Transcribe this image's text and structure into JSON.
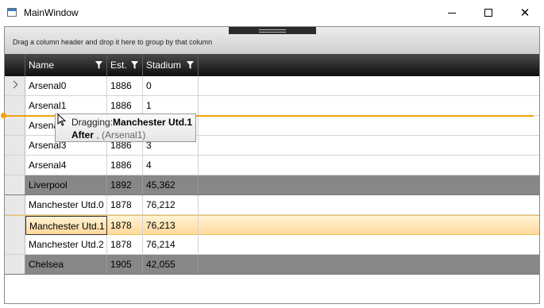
{
  "window": {
    "title": "MainWindow"
  },
  "grid": {
    "group_panel_text": "Drag a column header and drop it here to group by that column",
    "columns": [
      "Name",
      "Est.",
      "Stadium"
    ],
    "rows": [
      {
        "name": "Arsenal0",
        "est": "1886",
        "stadium": "0",
        "style": "normal",
        "current": true
      },
      {
        "name": "Arsenal1",
        "est": "1886",
        "stadium": "1",
        "style": "normal"
      },
      {
        "name": "Arsenal2",
        "est": "1886",
        "stadium": "2",
        "style": "normal"
      },
      {
        "name": "Arsenal3",
        "est": "1886",
        "stadium": "3",
        "style": "normal"
      },
      {
        "name": "Arsenal4",
        "est": "1886",
        "stadium": "4",
        "style": "normal"
      },
      {
        "name": "Liverpool",
        "est": "1892",
        "stadium": "45,362",
        "style": "alt"
      },
      {
        "name": "Manchester Utd.0",
        "est": "1878",
        "stadium": "76,212",
        "style": "normal"
      },
      {
        "name": "Manchester Utd.1",
        "est": "1878",
        "stadium": "76,213",
        "style": "selected"
      },
      {
        "name": "Manchester Utd.2",
        "est": "1878",
        "stadium": "76,214",
        "style": "normal"
      },
      {
        "name": "Chelsea",
        "est": "1905",
        "stadium": "42,055",
        "style": "alt"
      }
    ]
  },
  "drag_cue": {
    "prefix": "Dragging:",
    "item": "Manchester Utd.1",
    "position": "After",
    "target": ", (Arsenal1)"
  },
  "colors": {
    "drop_indicator": "#f0a30a",
    "selected_row": "#ffd99a",
    "alt_row": "#878787",
    "header": "#1a1a1a"
  }
}
